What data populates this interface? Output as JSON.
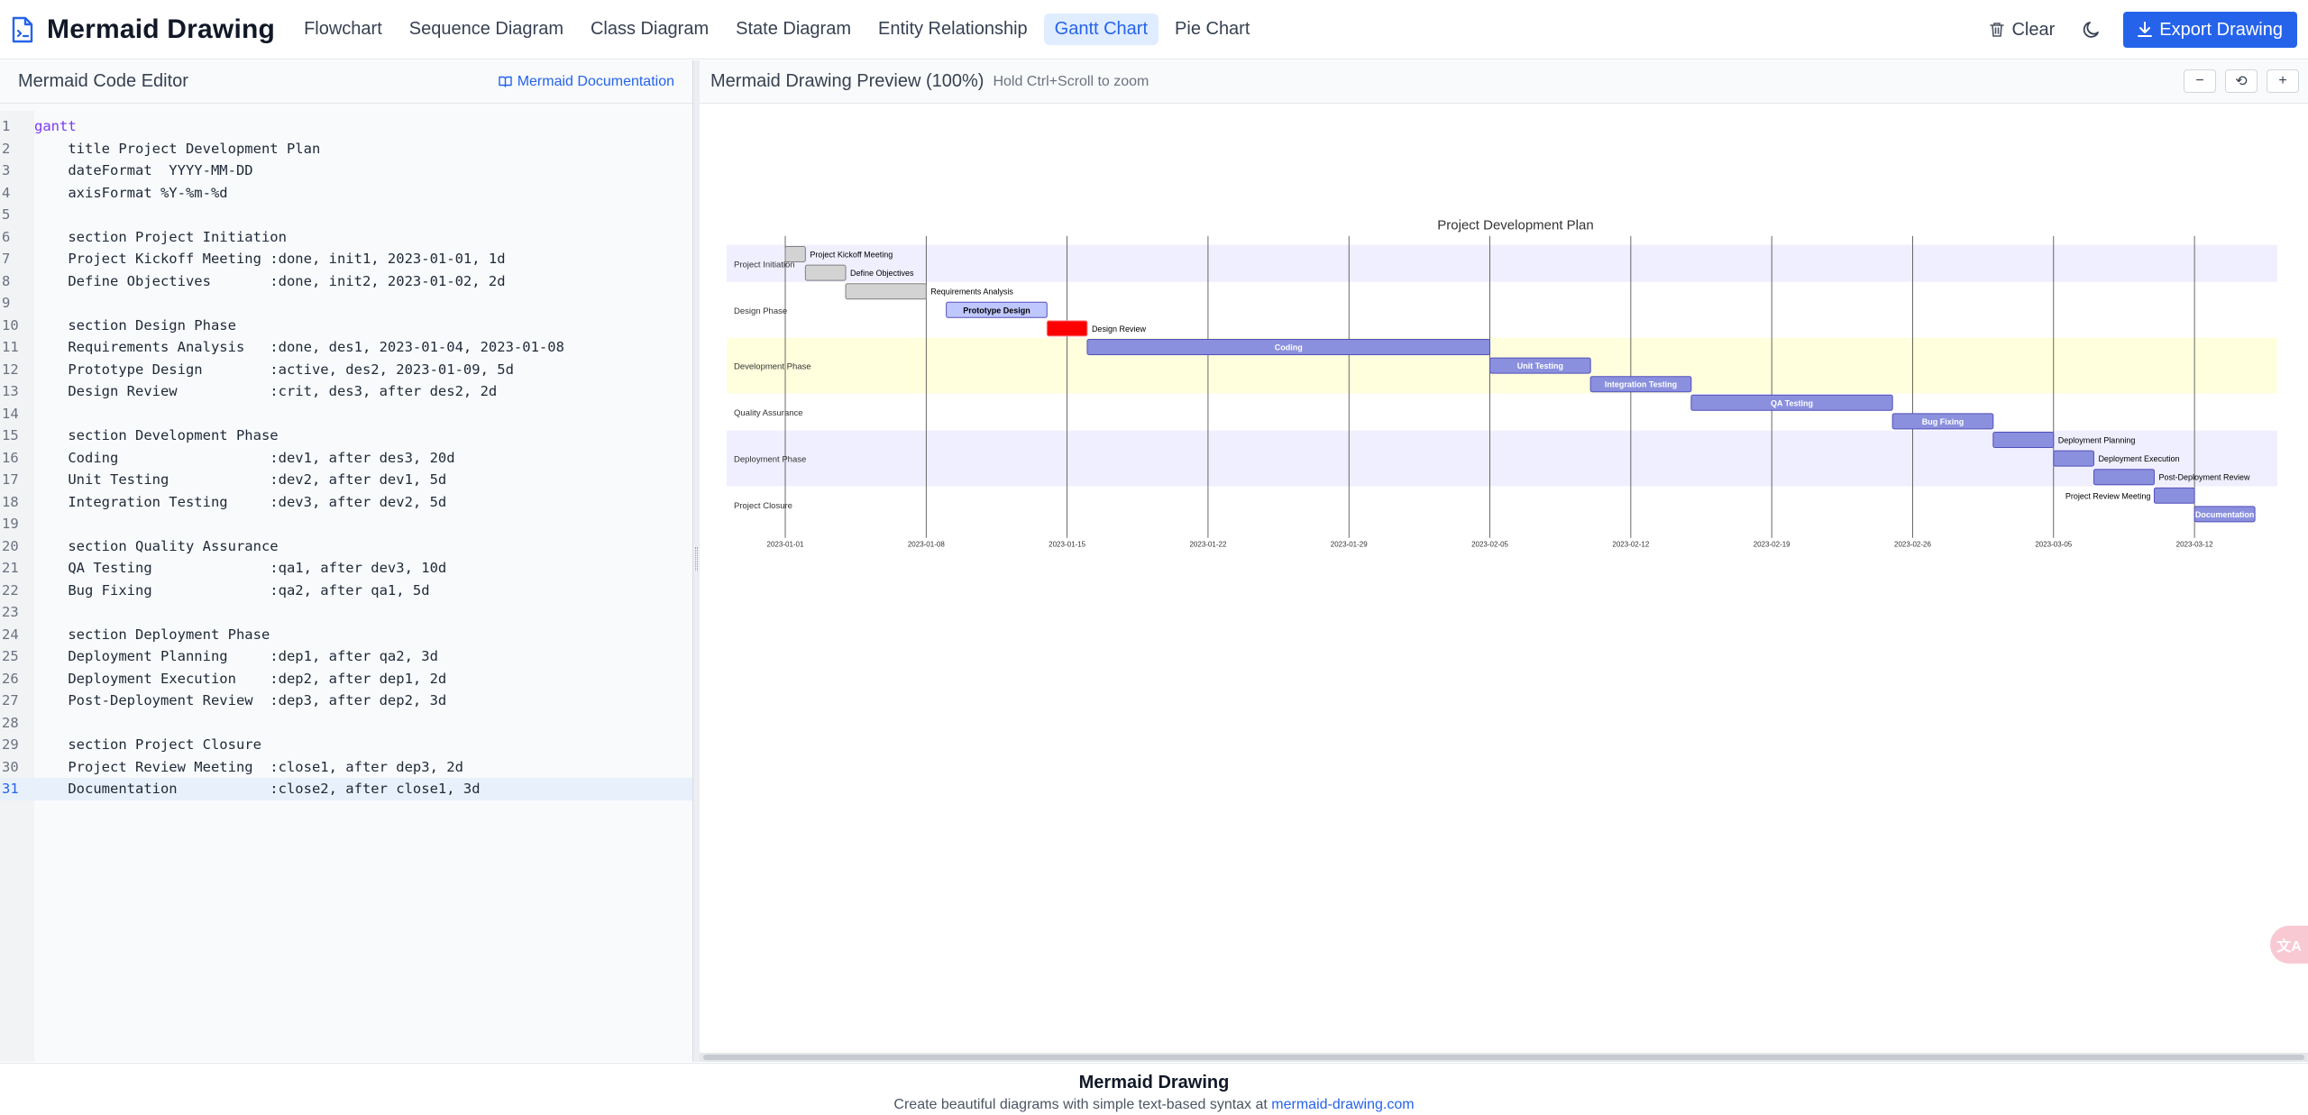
{
  "header": {
    "app_title": "Mermaid Drawing",
    "tabs": [
      {
        "label": "Flowchart",
        "active": false
      },
      {
        "label": "Sequence Diagram",
        "active": false
      },
      {
        "label": "Class Diagram",
        "active": false
      },
      {
        "label": "State Diagram",
        "active": false
      },
      {
        "label": "Entity Relationship",
        "active": false
      },
      {
        "label": "Gantt Chart",
        "active": true
      },
      {
        "label": "Pie Chart",
        "active": false
      }
    ],
    "clear_label": "Clear",
    "export_label": "Export Drawing",
    "accent_color": "#2563eb"
  },
  "editor": {
    "title": "Mermaid Code Editor",
    "doc_link": "Mermaid Documentation",
    "current_line": 31,
    "lines": [
      "gantt",
      "    title Project Development Plan",
      "    dateFormat  YYYY-MM-DD",
      "    axisFormat %Y-%m-%d",
      "",
      "    section Project Initiation",
      "    Project Kickoff Meeting :done, init1, 2023-01-01, 1d",
      "    Define Objectives       :done, init2, 2023-01-02, 2d",
      "",
      "    section Design Phase",
      "    Requirements Analysis   :done, des1, 2023-01-04, 2023-01-08",
      "    Prototype Design        :active, des2, 2023-01-09, 5d",
      "    Design Review           :crit, des3, after des2, 2d",
      "",
      "    section Development Phase",
      "    Coding                  :dev1, after des3, 20d",
      "    Unit Testing            :dev2, after dev1, 5d",
      "    Integration Testing     :dev3, after dev2, 5d",
      "",
      "    section Quality Assurance",
      "    QA Testing              :qa1, after dev3, 10d",
      "    Bug Fixing              :qa2, after qa1, 5d",
      "",
      "    section Deployment Phase",
      "    Deployment Planning     :dep1, after qa2, 3d",
      "    Deployment Execution    :dep2, after dep1, 2d",
      "    Post-Deployment Review  :dep3, after dep2, 3d",
      "",
      "    section Project Closure",
      "    Project Review Meeting  :close1, after dep3, 2d",
      "    Documentation           :close2, after close1, 3d"
    ]
  },
  "preview": {
    "title": "Mermaid Drawing Preview (100%)",
    "hint": "Hold Ctrl+Scroll to zoom",
    "zoom_out": "−",
    "zoom_reset": "⟲",
    "zoom_in": "+",
    "translate_badge": "文A"
  },
  "chart_data": {
    "type": "gantt",
    "title": "Project Development Plan",
    "start": "2023-01-01",
    "x_ticks": [
      "2023-01-01",
      "2023-01-08",
      "2023-01-15",
      "2023-01-22",
      "2023-01-29",
      "2023-02-05",
      "2023-02-12",
      "2023-02-19",
      "2023-02-26",
      "2023-03-05",
      "2023-03-12"
    ],
    "sections": [
      {
        "name": "Project Initiation",
        "tasks": [
          {
            "name": "Project Kickoff Meeting",
            "start": "2023-01-01",
            "end": "2023-01-02",
            "status": "done",
            "label_outside": true
          },
          {
            "name": "Define Objectives",
            "start": "2023-01-02",
            "end": "2023-01-04",
            "status": "done",
            "label_outside": true
          }
        ]
      },
      {
        "name": "Design Phase",
        "tasks": [
          {
            "name": "Requirements Analysis",
            "start": "2023-01-04",
            "end": "2023-01-08",
            "status": "done",
            "label_outside": true
          },
          {
            "name": "Prototype Design",
            "start": "2023-01-09",
            "end": "2023-01-14",
            "status": "active",
            "label_outside": false
          },
          {
            "name": "Design Review",
            "start": "2023-01-14",
            "end": "2023-01-16",
            "status": "crit",
            "label_outside": true
          }
        ]
      },
      {
        "name": "Development Phase",
        "tasks": [
          {
            "name": "Coding",
            "start": "2023-01-16",
            "end": "2023-02-05",
            "status": "normal",
            "label_outside": false
          },
          {
            "name": "Unit Testing",
            "start": "2023-02-05",
            "end": "2023-02-10",
            "status": "normal",
            "label_outside": false
          },
          {
            "name": "Integration Testing",
            "start": "2023-02-10",
            "end": "2023-02-15",
            "status": "normal",
            "label_outside": false
          }
        ]
      },
      {
        "name": "Quality Assurance",
        "tasks": [
          {
            "name": "QA Testing",
            "start": "2023-02-15",
            "end": "2023-02-25",
            "status": "normal",
            "label_outside": false
          },
          {
            "name": "Bug Fixing",
            "start": "2023-02-25",
            "end": "2023-03-02",
            "status": "normal",
            "label_outside": false
          }
        ]
      },
      {
        "name": "Deployment Phase",
        "tasks": [
          {
            "name": "Deployment Planning",
            "start": "2023-03-02",
            "end": "2023-03-05",
            "status": "normal",
            "label_outside": true
          },
          {
            "name": "Deployment Execution",
            "start": "2023-03-05",
            "end": "2023-03-07",
            "status": "normal",
            "label_outside": true
          },
          {
            "name": "Post-Deployment Review",
            "start": "2023-03-07",
            "end": "2023-03-10",
            "status": "normal",
            "label_outside": true
          }
        ]
      },
      {
        "name": "Project Closure",
        "tasks": [
          {
            "name": "Project Review Meeting",
            "start": "2023-03-10",
            "end": "2023-03-12",
            "status": "normal",
            "label_outside": "left"
          },
          {
            "name": "Documentation",
            "start": "2023-03-12",
            "end": "2023-03-15",
            "status": "normal",
            "label_outside": false
          }
        ]
      }
    ],
    "section_colors": [
      "#efefff",
      "#ffffff",
      "#ffffde",
      "#ffffff",
      "#efefff",
      "#ffffff"
    ],
    "status_colors": {
      "done": "#d3d3d3",
      "active": "#bfc7ff",
      "crit": "#ff0000",
      "normal": "#8a90dd"
    }
  },
  "footer": {
    "title": "Mermaid Drawing",
    "subtitle_prefix": "Create beautiful diagrams with simple text-based syntax at",
    "link": "mermaid-drawing.com"
  }
}
